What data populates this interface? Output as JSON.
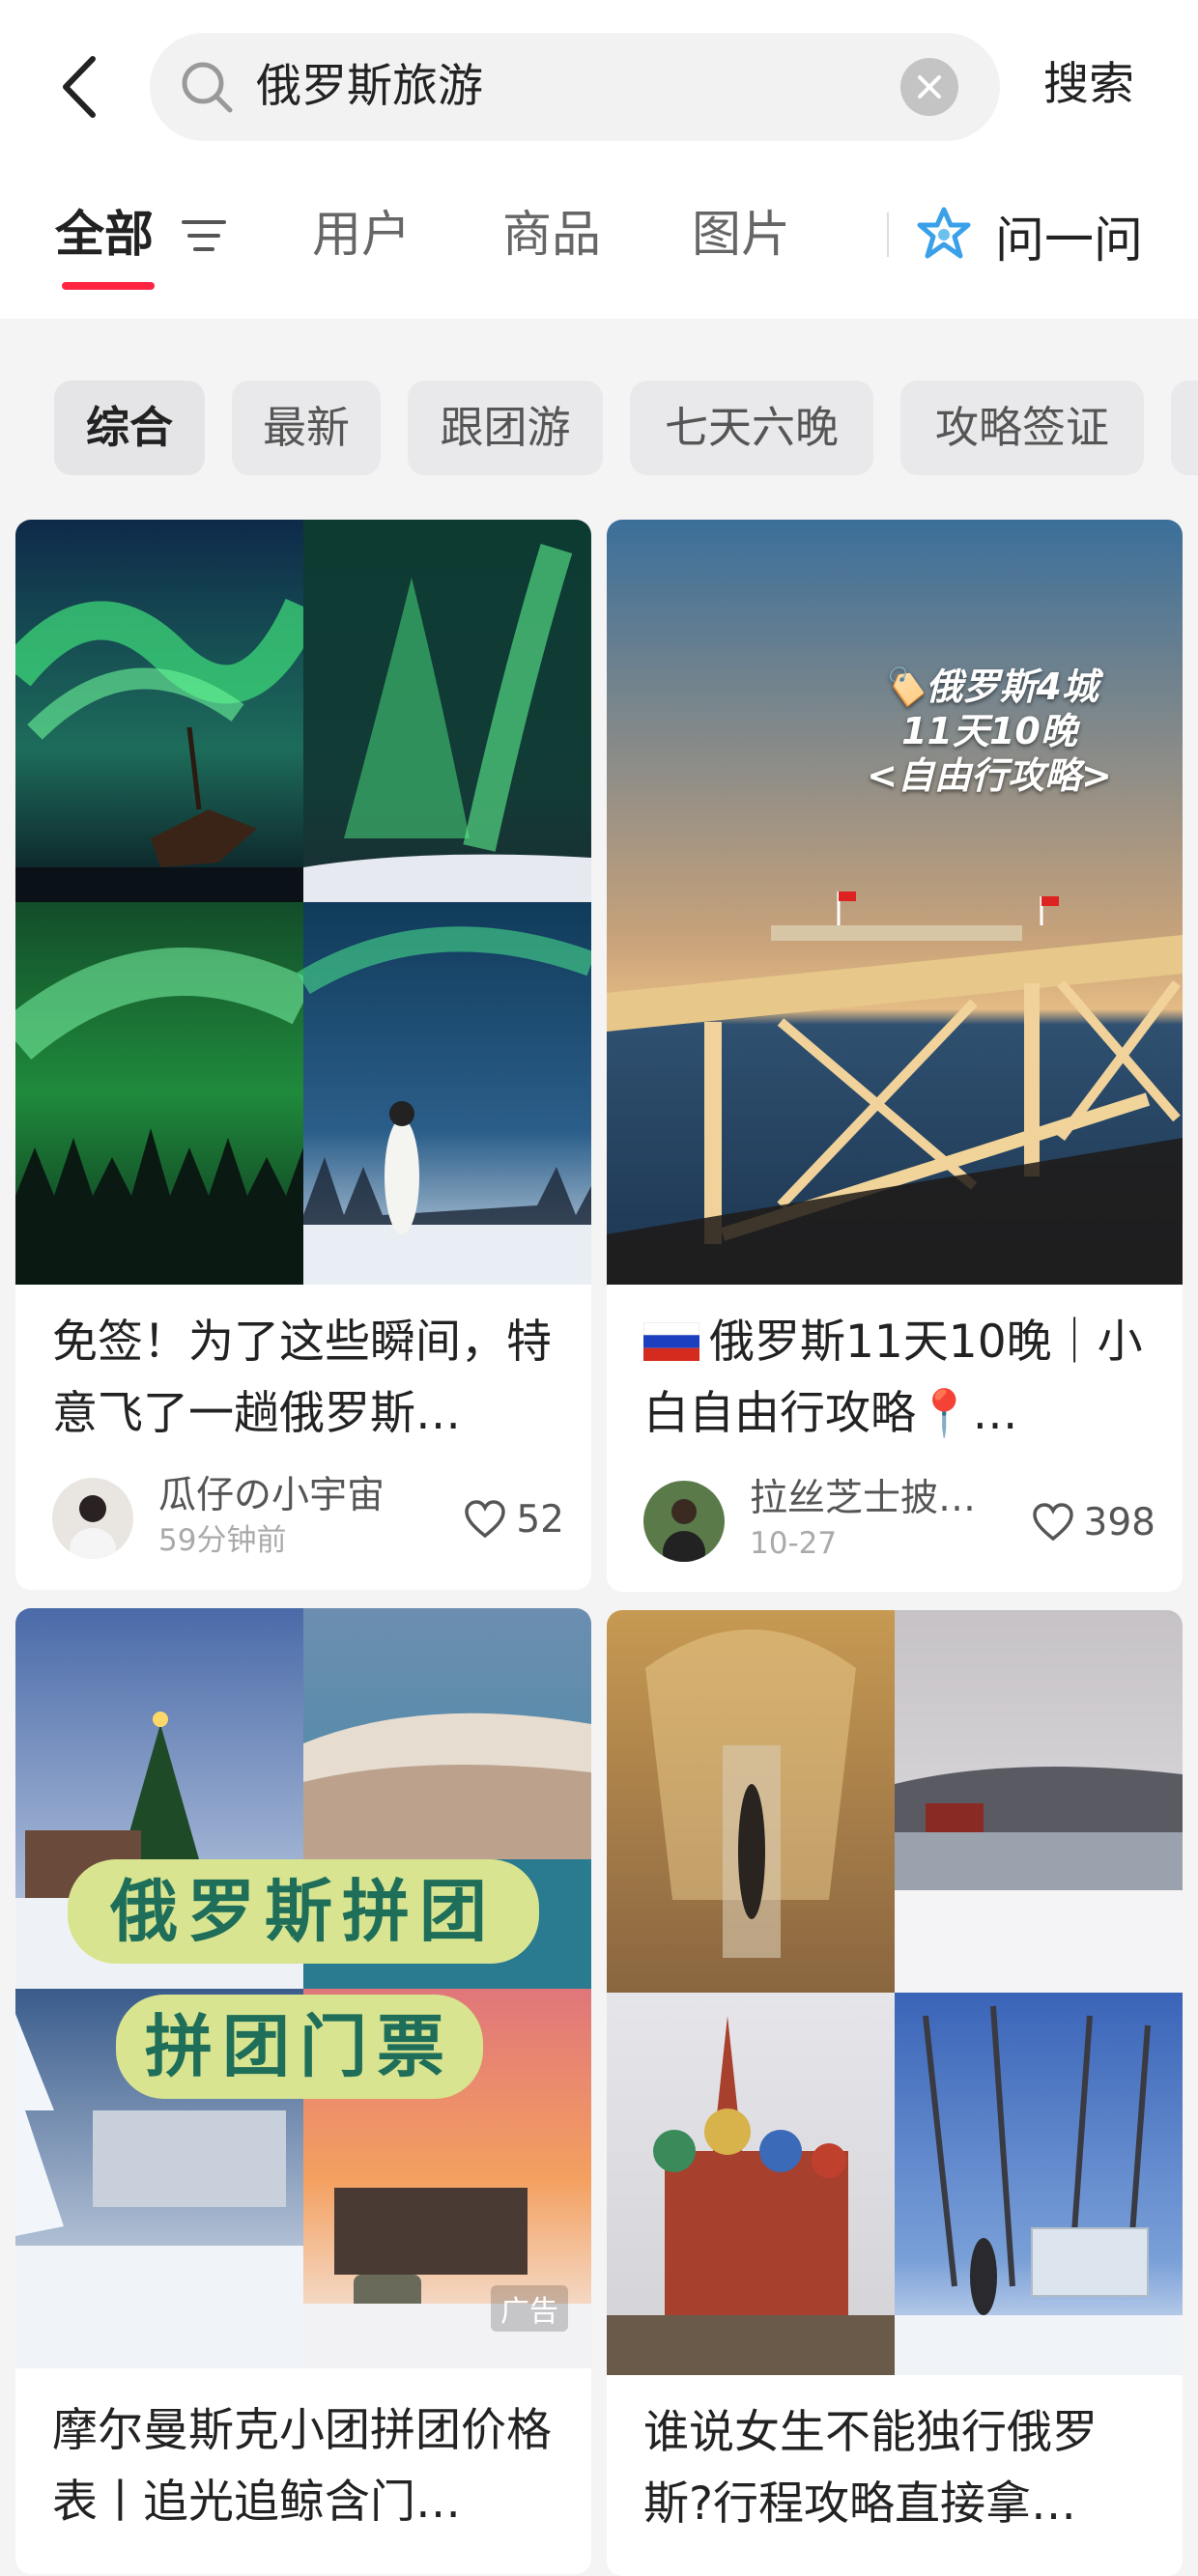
{
  "search": {
    "query": "俄罗斯旅游",
    "button_label": "搜索"
  },
  "tabs": [
    "全部",
    "用户",
    "商品",
    "图片"
  ],
  "ask": {
    "label": "问一问"
  },
  "chips": [
    "综合",
    "最新",
    "跟团游",
    "七天六晚",
    "攻略签证"
  ],
  "colors": {
    "accent": "#ff2442",
    "background": "#f4f4f5"
  },
  "cards": [
    {
      "title": "免签！为了这些瞬间，特意飞了一趟俄罗斯…",
      "author": "瓜仔の小宇宙",
      "time": "59分钟前",
      "likes": "52",
      "image": "aurora-collage"
    },
    {
      "title": "俄罗斯11天10晚｜小白自由行攻略📍…",
      "title_flag": "russia-flag-icon",
      "author": "拉丝芝士披…",
      "time": "10-27",
      "likes": "398",
      "overlay": [
        "🏷️俄罗斯4城",
        "11天10晚",
        "<自由行攻略>"
      ],
      "image": "pier-sunset"
    },
    {
      "title": "摩尔曼斯克小团拼团价格表丨追光追鲸含门…",
      "badge": "广告",
      "overlay": [
        "俄罗斯拼团",
        "拼团门票"
      ],
      "image": "murmansk-collage"
    },
    {
      "title": "谁说女生不能独行俄罗斯?行程攻略直接拿…",
      "image": "russia-landmarks-collage"
    }
  ]
}
